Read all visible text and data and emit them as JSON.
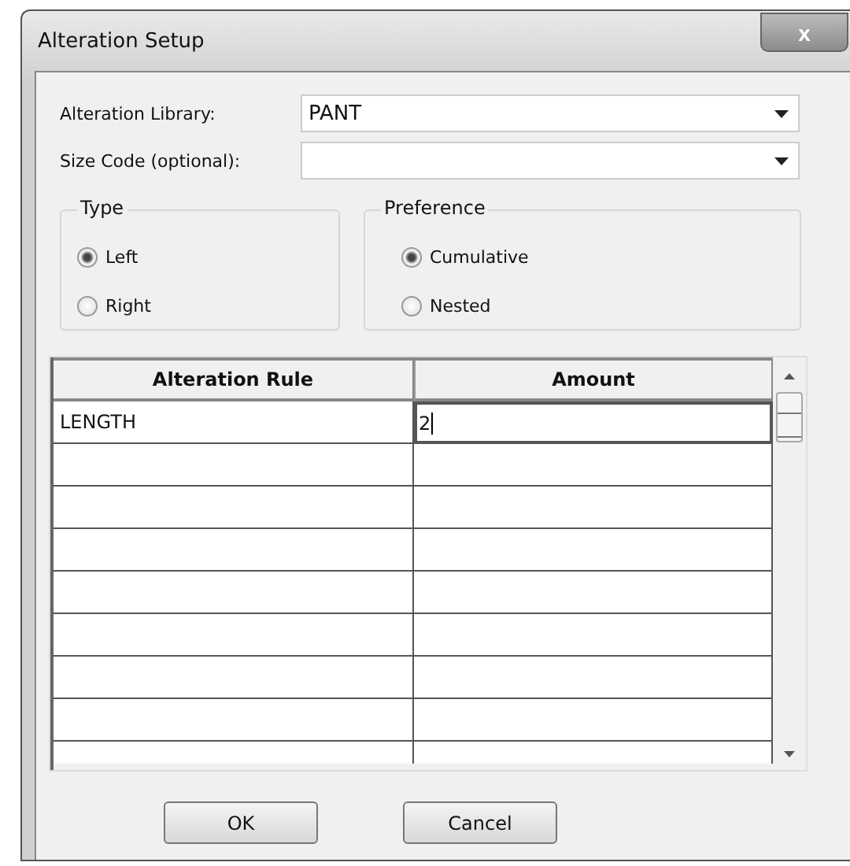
{
  "window": {
    "title": "Alteration Setup",
    "close": "x"
  },
  "fields": [
    {
      "label": "Alteration Library:",
      "value": "PANT"
    },
    {
      "label": "Size Code (optional):"
    }
  ],
  "groups": [
    {
      "title": "Type",
      "options": [
        {
          "label": "Left",
          "selected": true
        },
        {
          "label": "Right",
          "selected": false
        }
      ]
    },
    {
      "title": "Preference",
      "options": [
        {
          "label": "Cumulative",
          "selected": true
        },
        {
          "label": "Nested",
          "selected": false
        }
      ]
    }
  ],
  "table": {
    "columns": [
      "Alteration Rule",
      "Amount"
    ],
    "rows": [
      {
        "cells": [
          "LENGTH",
          "2"
        ],
        "editing": true
      }
    ]
  },
  "buttons": [
    "OK",
    "Cancel"
  ]
}
